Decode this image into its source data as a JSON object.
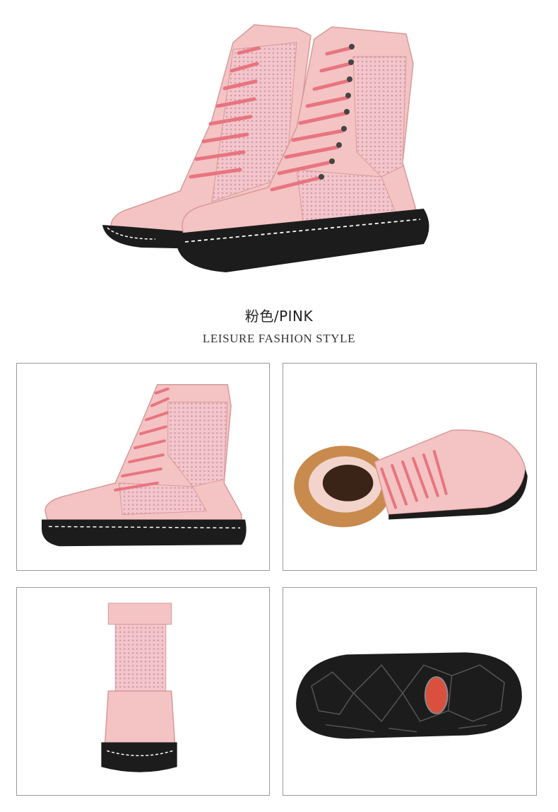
{
  "product": {
    "color_label": "粉色/PINK",
    "style_label": "LEISURE FASHION STYLE"
  },
  "colors": {
    "leather": "#f4c3c3",
    "leather_shade": "#e8a9a9",
    "mesh": "#f0bcc4",
    "lace": "#e8747f",
    "sole": "#1c1c1c",
    "stitch": "#ffffff",
    "heel_collar": "#c98a4e",
    "sole_badge": "#d9513e"
  },
  "views": [
    {
      "name": "side"
    },
    {
      "name": "top"
    },
    {
      "name": "back"
    },
    {
      "name": "outsole"
    }
  ]
}
